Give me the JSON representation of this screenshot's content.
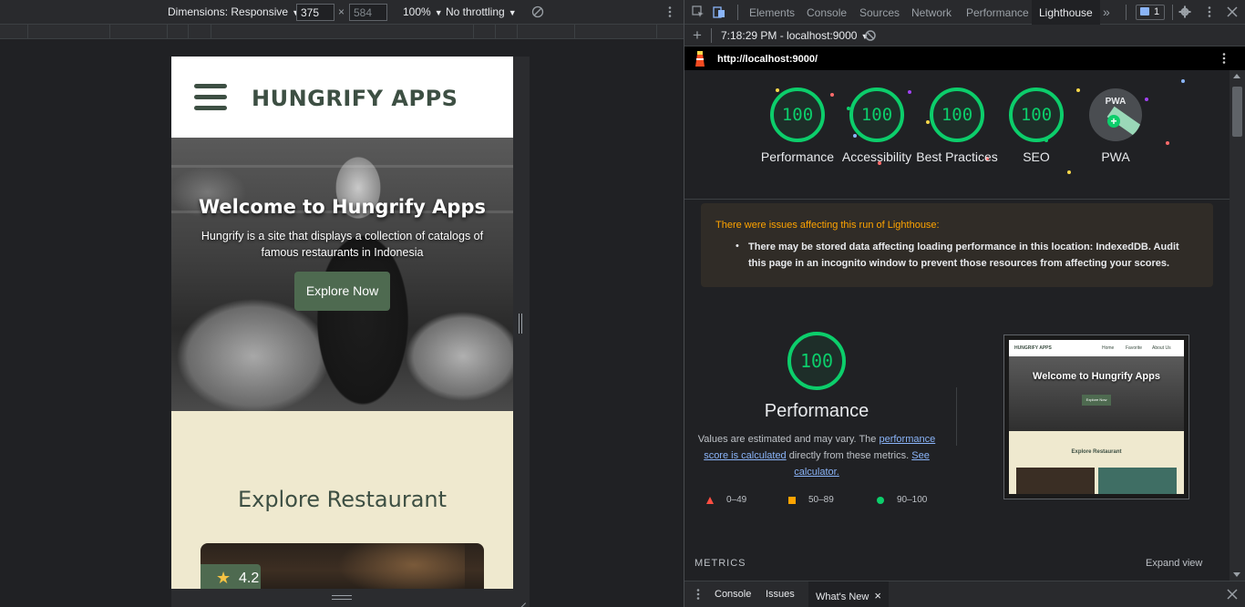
{
  "device_toolbar": {
    "dimensions_label": "Dimensions: Responsive",
    "width_value": "375",
    "height_value": "584",
    "times": "×",
    "zoom": "100%",
    "throttling": "No throttling"
  },
  "site": {
    "title": "HUNGRIFY APPS",
    "hero_title": "Welcome to Hungrify Apps",
    "hero_subtitle": "Hungrify is a site that displays a collection of catalogs of famous restaurants in Indonesia",
    "hero_button": "Explore Now",
    "explore_title": "Explore Restaurant",
    "card_rating": "4.2",
    "star": "★"
  },
  "devtools": {
    "tabs": [
      "Elements",
      "Console",
      "Sources",
      "Network",
      "Performance",
      "Lighthouse"
    ],
    "active_tab": "Lighthouse",
    "more_tabs": "»",
    "issues_count": "1",
    "lh_toolbar": {
      "plus": "+",
      "run_label": "7:18:29 PM - localhost:9000"
    },
    "url": "http://localhost:9000/"
  },
  "scores": [
    {
      "label": "Performance",
      "value": "100"
    },
    {
      "label": "Accessibility",
      "value": "100"
    },
    {
      "label": "Best Practices",
      "value": "100"
    },
    {
      "label": "SEO",
      "value": "100"
    },
    {
      "label": "PWA",
      "value": ""
    }
  ],
  "pwa_badge_text": "PWA",
  "warning": {
    "title": "There were issues affecting this run of Lighthouse:",
    "message": "There may be stored data affecting loading performance in this location: IndexedDB. Audit this page in an incognito window to prevent those resources from affecting your scores."
  },
  "performance": {
    "score": "100",
    "title": "Performance",
    "desc_pre": "Values are estimated and may vary. The ",
    "desc_link1": "performance score is calculated",
    "desc_mid": " directly from these metrics. ",
    "desc_link2": "See calculator."
  },
  "legend": [
    {
      "range": "0–49",
      "color": "#ff4e42"
    },
    {
      "range": "50–89",
      "color": "#ffa400"
    },
    {
      "range": "90–100",
      "color": "#0cce6b"
    }
  ],
  "thumbnail": {
    "brand": "HUNGRIFY APPS",
    "nav": [
      "Home",
      "Favorite",
      "About Us"
    ],
    "hero_title": "Welcome to Hungrify Apps",
    "button": "Explore Now",
    "explore": "Explore Restaurant"
  },
  "metrics_label": "METRICS",
  "expand_view": "Expand view",
  "drawer": {
    "tabs": [
      "Console",
      "Issues",
      "What's New"
    ],
    "active": "What's New",
    "close": "×"
  },
  "colors": {
    "pass": "#0cce6b",
    "average": "#ffa400",
    "fail": "#ff4e42",
    "brand_green": "#4e6a50"
  }
}
